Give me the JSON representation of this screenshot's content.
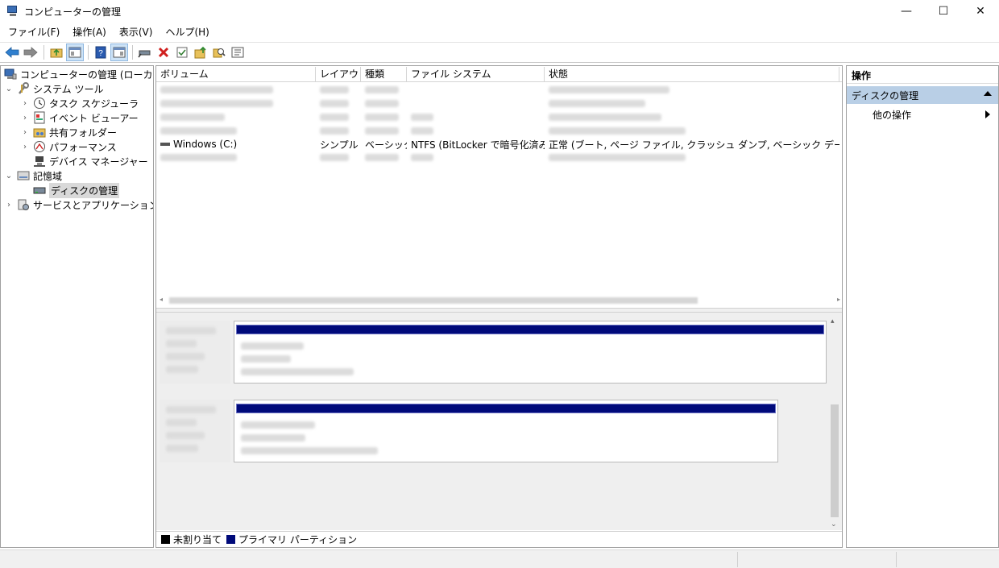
{
  "window": {
    "title": "コンピューターの管理",
    "minimize": "—",
    "maximize": "☐",
    "close": "✕"
  },
  "menu": [
    "ファイル(F)",
    "操作(A)",
    "表示(V)",
    "ヘルプ(H)"
  ],
  "tree": {
    "root": "コンピューターの管理 (ローカル)",
    "system_tools": "システム ツール",
    "task_scheduler": "タスク スケジューラ",
    "event_viewer": "イベント ビューアー",
    "shared_folders": "共有フォルダー",
    "performance": "パフォーマンス",
    "device_manager": "デバイス マネージャー",
    "storage": "記憶域",
    "disk_management": "ディスクの管理",
    "services": "サービスとアプリケーション"
  },
  "volumes": {
    "columns": [
      "ボリューム",
      "レイアウト",
      "種類",
      "ファイル システム",
      "状態"
    ],
    "visible_row": {
      "volume": "Windows (C:)",
      "layout": "シンプル",
      "type": "ベーシック",
      "fs": "NTFS (BitLocker で暗号化済み)",
      "status": "正常 (ブート, ページ ファイル, クラッシュ ダンプ, ベーシック データ パーティション)"
    }
  },
  "legend": {
    "unallocated": "未割り当て",
    "primary": "プライマリ パーティション",
    "unallocated_color": "#000000",
    "primary_color": "#000a7a"
  },
  "actions": {
    "header": "操作",
    "section": "ディスクの管理",
    "more": "他の操作"
  }
}
